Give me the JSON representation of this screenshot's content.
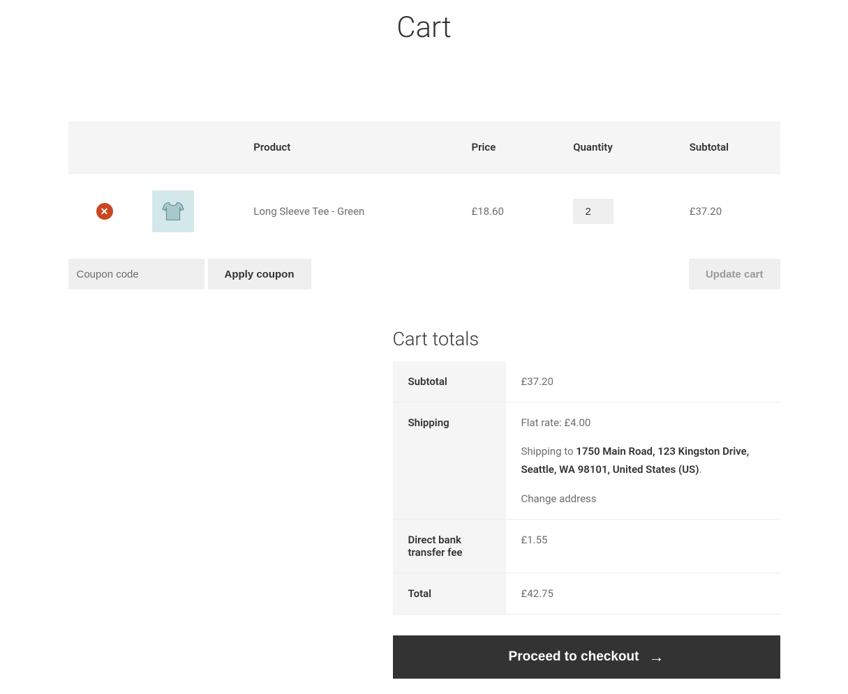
{
  "page": {
    "title": "Cart"
  },
  "cart": {
    "headers": {
      "product": "Product",
      "price": "Price",
      "quantity": "Quantity",
      "subtotal": "Subtotal"
    },
    "items": [
      {
        "name": "Long Sleeve Tee - Green",
        "price": "£18.60",
        "quantity": "2",
        "subtotal": "£37.20"
      }
    ],
    "coupon": {
      "placeholder": "Coupon code",
      "apply_label": "Apply coupon"
    },
    "update_label": "Update cart"
  },
  "totals": {
    "heading": "Cart totals",
    "rows": {
      "subtotal_label": "Subtotal",
      "subtotal_value": "£37.20",
      "shipping_label": "Shipping",
      "shipping_rate": "Flat rate: £4.00",
      "shipping_to_prefix": "Shipping to ",
      "shipping_address": "1750 Main Road, 123 Kingston Drive, Seattle, WA 98101, United States (US)",
      "change_address": "Change address",
      "fee_label": "Direct bank transfer fee",
      "fee_value": "£1.55",
      "total_label": "Total",
      "total_value": "£42.75"
    },
    "checkout_button": "Proceed to checkout"
  }
}
